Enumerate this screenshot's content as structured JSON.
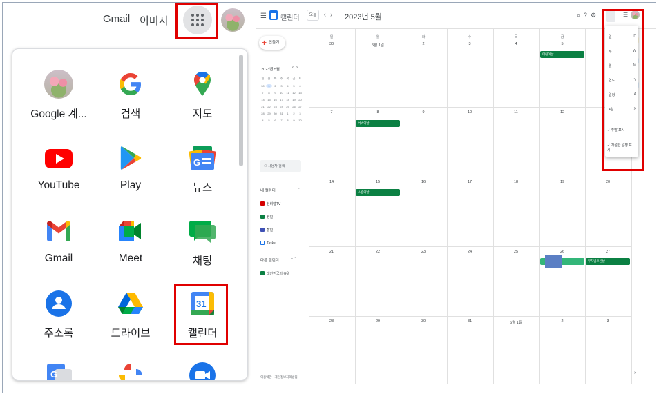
{
  "left": {
    "top_links": [
      "Gmail",
      "이미지"
    ],
    "apps": [
      {
        "label": "Google 계...",
        "icon": "account-avatar-icon"
      },
      {
        "label": "검색",
        "icon": "google-search-icon"
      },
      {
        "label": "지도",
        "icon": "maps-icon"
      },
      {
        "label": "YouTube",
        "icon": "youtube-icon"
      },
      {
        "label": "Play",
        "icon": "play-store-icon"
      },
      {
        "label": "뉴스",
        "icon": "news-icon"
      },
      {
        "label": "Gmail",
        "icon": "gmail-icon"
      },
      {
        "label": "Meet",
        "icon": "meet-icon"
      },
      {
        "label": "채팅",
        "icon": "chat-icon"
      },
      {
        "label": "주소록",
        "icon": "contacts-icon"
      },
      {
        "label": "드라이브",
        "icon": "drive-icon"
      },
      {
        "label": "캘린더",
        "icon": "calendar-icon"
      }
    ],
    "calendar_icon_number": "31"
  },
  "calendar": {
    "app_title": "캘린더",
    "today_label": "오늘",
    "month_label": "2023년 5월",
    "view_button": "월",
    "create_label": "만들기",
    "mini_title": "2023년 5월",
    "mini_days_header": [
      "일",
      "월",
      "화",
      "수",
      "목",
      "금",
      "토"
    ],
    "mini_days": [
      "30",
      "1",
      "2",
      "3",
      "4",
      "5",
      "6",
      "7",
      "8",
      "9",
      "10",
      "11",
      "12",
      "13",
      "14",
      "15",
      "16",
      "17",
      "18",
      "19",
      "20",
      "21",
      "22",
      "23",
      "24",
      "25",
      "26",
      "27",
      "28",
      "29",
      "30",
      "31",
      "1",
      "2",
      "3",
      "4",
      "5",
      "6",
      "7",
      "8",
      "9",
      "10"
    ],
    "search_people": "사용자 검색",
    "my_calendars_title": "내 캘린더",
    "my_calendars": [
      {
        "label": "선비탭TV",
        "color": "#d50000"
      },
      {
        "label": "생일",
        "color": "#0b8043"
      },
      {
        "label": "할일",
        "color": "#3f51b5"
      },
      {
        "label": "Tasks",
        "color": "#ffffff"
      }
    ],
    "other_calendars_title": "다른 캘린더",
    "other_calendars": [
      {
        "label": "대한민국의 휴일",
        "color": "#0b8043"
      }
    ],
    "footer": "이용약관 - 개인정보처리방침",
    "dow": [
      "일",
      "월",
      "화",
      "수",
      "목",
      "금",
      "토"
    ],
    "weeks": [
      [
        "30",
        "5월 1일",
        "2",
        "3",
        "4",
        "5",
        "6"
      ],
      [
        "7",
        "8",
        "9",
        "10",
        "11",
        "12",
        "13"
      ],
      [
        "14",
        "15",
        "16",
        "17",
        "18",
        "19",
        "20"
      ],
      [
        "21",
        "22",
        "23",
        "24",
        "25",
        "26",
        "27"
      ],
      [
        "28",
        "29",
        "30",
        "31",
        "6월 1일",
        "2",
        "3"
      ]
    ],
    "events": {
      "childrens_day": "어린이날",
      "parents_day": "어버이날",
      "teachers_day": "스승의날",
      "buddha_day": "부처님오신날"
    },
    "view_menu": [
      {
        "label": "일",
        "key": "D"
      },
      {
        "label": "주",
        "key": "W"
      },
      {
        "label": "월",
        "key": "M"
      },
      {
        "label": "연도",
        "key": "Y"
      },
      {
        "label": "일정",
        "key": "A"
      },
      {
        "label": "4일",
        "key": "X"
      }
    ],
    "view_options": [
      "주말 표시",
      "거절한 일정 표시"
    ]
  }
}
